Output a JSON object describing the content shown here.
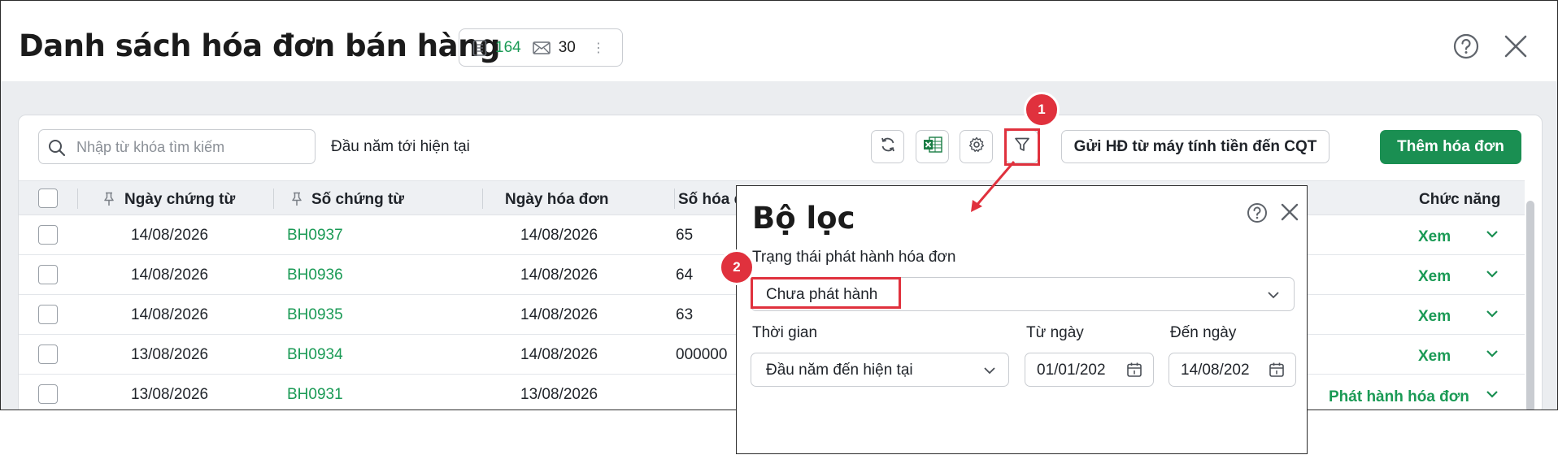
{
  "header": {
    "title": "Danh sách hóa đơn bán hàng",
    "count_invoices": "164",
    "count_mail": "30",
    "count_menu": "⋮"
  },
  "toolbar": {
    "search_placeholder": "Nhập từ khóa tìm kiếm",
    "period": "Đầu năm tới hiện tại",
    "send_label": "Gửi HĐ từ máy tính tiền đến CQT",
    "add_label": "Thêm hóa đơn"
  },
  "table": {
    "columns": [
      "Ngày chứng từ",
      "Số chứng từ",
      "Ngày hóa đơn",
      "Số hóa đ",
      "Chức năng"
    ],
    "rows": [
      {
        "doc_date": "14/08/2026",
        "doc_no": "BH0937",
        "inv_date": "14/08/2026",
        "inv_no": "65",
        "action": "Xem"
      },
      {
        "doc_date": "14/08/2026",
        "doc_no": "BH0936",
        "inv_date": "14/08/2026",
        "inv_no": "64",
        "action": "Xem"
      },
      {
        "doc_date": "14/08/2026",
        "doc_no": "BH0935",
        "inv_date": "14/08/2026",
        "inv_no": "63",
        "action": "Xem"
      },
      {
        "doc_date": "13/08/2026",
        "doc_no": "BH0934",
        "inv_date": "14/08/2026",
        "inv_no": "000000",
        "action": "Xem"
      },
      {
        "doc_date": "13/08/2026",
        "doc_no": "BH0931",
        "inv_date": "13/08/2026",
        "inv_no": "",
        "action": "Phát hành hóa đơn"
      }
    ]
  },
  "filter_panel": {
    "title": "Bộ lọc",
    "status_label": "Trạng thái phát hành hóa đơn",
    "status_value": "Chưa phát hành",
    "time_label": "Thời gian",
    "time_value": "Đầu năm đến hiện tại",
    "from_label": "Từ ngày",
    "from_value": "01/01/202",
    "to_label": "Đến ngày",
    "to_value": "14/08/202"
  },
  "annotations": {
    "step1": "1",
    "step2": "2"
  },
  "colors": {
    "accent_green": "#1a8f52",
    "link_green": "#1a9a55",
    "highlight_red": "#e0313d"
  },
  "icons": [
    "document-icon",
    "mail-icon",
    "help-icon",
    "close-icon",
    "search-icon",
    "refresh-icon",
    "excel-icon",
    "gear-icon",
    "filter-icon",
    "pin-icon",
    "chevron-down-icon",
    "calendar-icon"
  ]
}
